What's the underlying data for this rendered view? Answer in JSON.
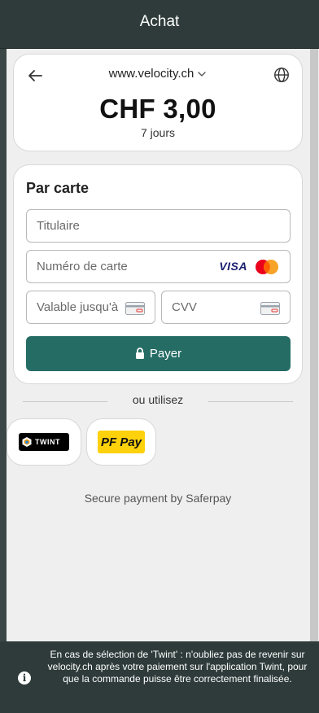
{
  "header": {
    "title": "Achat"
  },
  "merchant": {
    "site": "www.velocity.ch",
    "amount": "CHF 3,00",
    "duration": "7 jours"
  },
  "icons": {
    "back": "arrow-left-icon",
    "site_dropdown": "chevron-down-icon",
    "language": "globe-icon",
    "lock": "lock-icon",
    "info": "info-icon",
    "card": "card-icon"
  },
  "card_form": {
    "title": "Par carte",
    "holder_placeholder": "Titulaire",
    "number_placeholder": "Numéro de carte",
    "expiry_placeholder": "Valable jusqu'à",
    "cvv_placeholder": "CVV",
    "visa_label": "VISA",
    "pay_label": "Payer"
  },
  "alternatives": {
    "divider_text": "ou utilisez",
    "twint_label": "TWINT",
    "pfpay_label": "PF Pay"
  },
  "footer": {
    "secure_text": "Secure payment by Saferpay"
  },
  "notice": {
    "text": "En cas de sélection de 'Twint' : n'oubliez pas de revenir sur velocity.ch après votre paiement sur l'application Twint, pour que la commande puisse être correctement finalisée."
  },
  "colors": {
    "bar": "#2e3b3a",
    "primary": "#256c64",
    "pfpay": "#fdd10b",
    "mastercard_red": "#eb001b",
    "mastercard_orange": "#f79e1b",
    "visa": "#1a1f71"
  }
}
